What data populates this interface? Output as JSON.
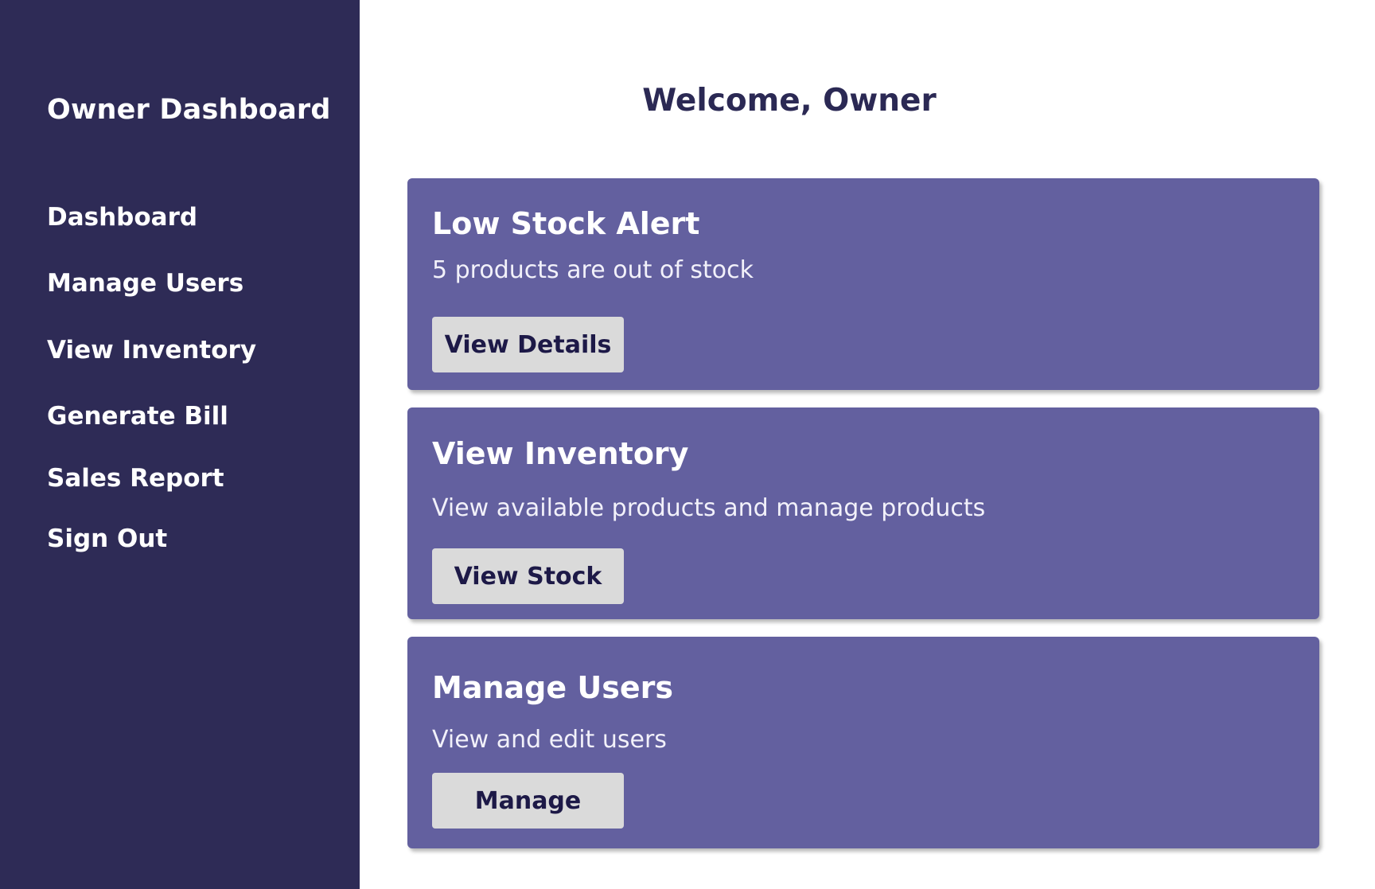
{
  "sidebar": {
    "title": "Owner Dashboard",
    "items": [
      {
        "label": "Dashboard"
      },
      {
        "label": "Manage Users"
      },
      {
        "label": "View Inventory"
      },
      {
        "label": "Generate Bill"
      },
      {
        "label": "Sales Report"
      },
      {
        "label": "Sign Out"
      }
    ]
  },
  "main": {
    "welcome": "Welcome, Owner",
    "cards": [
      {
        "title": "Low Stock Alert",
        "description": "5 products are out of stock",
        "button": "View Details"
      },
      {
        "title": "View Inventory",
        "description": "View available products and manage products",
        "button": "View Stock"
      },
      {
        "title": "Manage Users",
        "description": "View and edit users",
        "button": "Manage"
      }
    ]
  },
  "colors": {
    "sidebar_bg": "#2e2b56",
    "card_bg": "#63609f",
    "button_bg": "#dadada",
    "button_text": "#1d1947",
    "heading_text": "#2b2954"
  }
}
